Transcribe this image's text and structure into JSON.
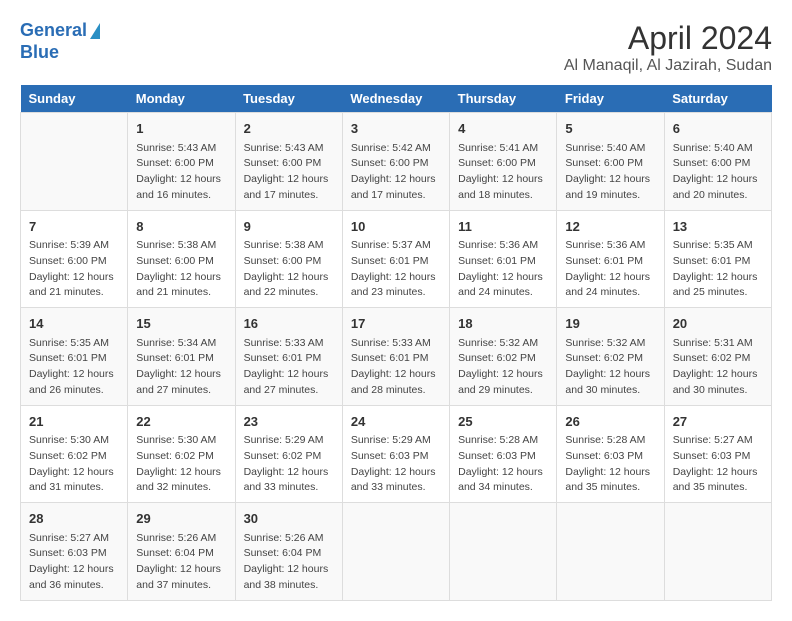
{
  "logo": {
    "line1": "General",
    "line2": "Blue"
  },
  "title": "April 2024",
  "subtitle": "Al Manaqil, Al Jazirah, Sudan",
  "days_header": [
    "Sunday",
    "Monday",
    "Tuesday",
    "Wednesday",
    "Thursday",
    "Friday",
    "Saturday"
  ],
  "weeks": [
    [
      {
        "day": "",
        "info": ""
      },
      {
        "day": "1",
        "info": "Sunrise: 5:43 AM\nSunset: 6:00 PM\nDaylight: 12 hours\nand 16 minutes."
      },
      {
        "day": "2",
        "info": "Sunrise: 5:43 AM\nSunset: 6:00 PM\nDaylight: 12 hours\nand 17 minutes."
      },
      {
        "day": "3",
        "info": "Sunrise: 5:42 AM\nSunset: 6:00 PM\nDaylight: 12 hours\nand 17 minutes."
      },
      {
        "day": "4",
        "info": "Sunrise: 5:41 AM\nSunset: 6:00 PM\nDaylight: 12 hours\nand 18 minutes."
      },
      {
        "day": "5",
        "info": "Sunrise: 5:40 AM\nSunset: 6:00 PM\nDaylight: 12 hours\nand 19 minutes."
      },
      {
        "day": "6",
        "info": "Sunrise: 5:40 AM\nSunset: 6:00 PM\nDaylight: 12 hours\nand 20 minutes."
      }
    ],
    [
      {
        "day": "7",
        "info": "Sunrise: 5:39 AM\nSunset: 6:00 PM\nDaylight: 12 hours\nand 21 minutes."
      },
      {
        "day": "8",
        "info": "Sunrise: 5:38 AM\nSunset: 6:00 PM\nDaylight: 12 hours\nand 21 minutes."
      },
      {
        "day": "9",
        "info": "Sunrise: 5:38 AM\nSunset: 6:00 PM\nDaylight: 12 hours\nand 22 minutes."
      },
      {
        "day": "10",
        "info": "Sunrise: 5:37 AM\nSunset: 6:01 PM\nDaylight: 12 hours\nand 23 minutes."
      },
      {
        "day": "11",
        "info": "Sunrise: 5:36 AM\nSunset: 6:01 PM\nDaylight: 12 hours\nand 24 minutes."
      },
      {
        "day": "12",
        "info": "Sunrise: 5:36 AM\nSunset: 6:01 PM\nDaylight: 12 hours\nand 24 minutes."
      },
      {
        "day": "13",
        "info": "Sunrise: 5:35 AM\nSunset: 6:01 PM\nDaylight: 12 hours\nand 25 minutes."
      }
    ],
    [
      {
        "day": "14",
        "info": "Sunrise: 5:35 AM\nSunset: 6:01 PM\nDaylight: 12 hours\nand 26 minutes."
      },
      {
        "day": "15",
        "info": "Sunrise: 5:34 AM\nSunset: 6:01 PM\nDaylight: 12 hours\nand 27 minutes."
      },
      {
        "day": "16",
        "info": "Sunrise: 5:33 AM\nSunset: 6:01 PM\nDaylight: 12 hours\nand 27 minutes."
      },
      {
        "day": "17",
        "info": "Sunrise: 5:33 AM\nSunset: 6:01 PM\nDaylight: 12 hours\nand 28 minutes."
      },
      {
        "day": "18",
        "info": "Sunrise: 5:32 AM\nSunset: 6:02 PM\nDaylight: 12 hours\nand 29 minutes."
      },
      {
        "day": "19",
        "info": "Sunrise: 5:32 AM\nSunset: 6:02 PM\nDaylight: 12 hours\nand 30 minutes."
      },
      {
        "day": "20",
        "info": "Sunrise: 5:31 AM\nSunset: 6:02 PM\nDaylight: 12 hours\nand 30 minutes."
      }
    ],
    [
      {
        "day": "21",
        "info": "Sunrise: 5:30 AM\nSunset: 6:02 PM\nDaylight: 12 hours\nand 31 minutes."
      },
      {
        "day": "22",
        "info": "Sunrise: 5:30 AM\nSunset: 6:02 PM\nDaylight: 12 hours\nand 32 minutes."
      },
      {
        "day": "23",
        "info": "Sunrise: 5:29 AM\nSunset: 6:02 PM\nDaylight: 12 hours\nand 33 minutes."
      },
      {
        "day": "24",
        "info": "Sunrise: 5:29 AM\nSunset: 6:03 PM\nDaylight: 12 hours\nand 33 minutes."
      },
      {
        "day": "25",
        "info": "Sunrise: 5:28 AM\nSunset: 6:03 PM\nDaylight: 12 hours\nand 34 minutes."
      },
      {
        "day": "26",
        "info": "Sunrise: 5:28 AM\nSunset: 6:03 PM\nDaylight: 12 hours\nand 35 minutes."
      },
      {
        "day": "27",
        "info": "Sunrise: 5:27 AM\nSunset: 6:03 PM\nDaylight: 12 hours\nand 35 minutes."
      }
    ],
    [
      {
        "day": "28",
        "info": "Sunrise: 5:27 AM\nSunset: 6:03 PM\nDaylight: 12 hours\nand 36 minutes."
      },
      {
        "day": "29",
        "info": "Sunrise: 5:26 AM\nSunset: 6:04 PM\nDaylight: 12 hours\nand 37 minutes."
      },
      {
        "day": "30",
        "info": "Sunrise: 5:26 AM\nSunset: 6:04 PM\nDaylight: 12 hours\nand 38 minutes."
      },
      {
        "day": "",
        "info": ""
      },
      {
        "day": "",
        "info": ""
      },
      {
        "day": "",
        "info": ""
      },
      {
        "day": "",
        "info": ""
      }
    ]
  ]
}
